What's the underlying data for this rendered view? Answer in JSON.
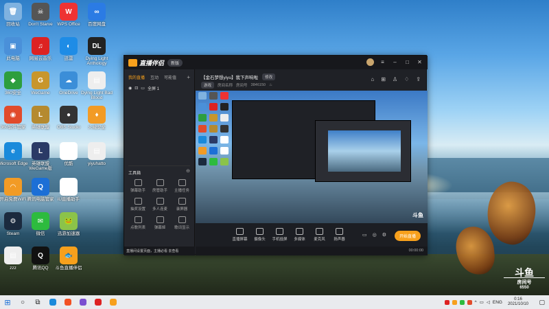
{
  "desktop_icons": [
    {
      "label": "回收站",
      "color": "#7fb2e0",
      "glyph": "🗑"
    },
    {
      "label": "Don't Starve",
      "color": "#555",
      "glyph": "☠"
    },
    {
      "label": "WPS Office",
      "color": "#e33",
      "glyph": "W"
    },
    {
      "label": "百度网盘",
      "color": "#2b7be4",
      "glyph": "∞"
    },
    {
      "label": "此电脑",
      "color": "#4a90d9",
      "glyph": "▣"
    },
    {
      "label": "网易云音乐",
      "color": "#d22",
      "glyph": "♫"
    },
    {
      "label": "迅雷",
      "color": "#1e8ce6",
      "glyph": "◐"
    },
    {
      "label": "Dying Light Anthology",
      "color": "#222",
      "glyph": "DL"
    },
    {
      "label": "360安全",
      "color": "#2d9e3e",
      "glyph": "◆"
    },
    {
      "label": "WeGame",
      "color": "#c8962c",
      "glyph": "G"
    },
    {
      "label": "OneDrive",
      "color": "#3b8ed8",
      "glyph": "☁"
    },
    {
      "label": "Dying Light Bad Blood",
      "color": "#eee",
      "glyph": "▤"
    },
    {
      "label": "360软件管家",
      "color": "#e14b2b",
      "glyph": "◉"
    },
    {
      "label": "英雄联盟",
      "color": "#b58a30",
      "glyph": "L"
    },
    {
      "label": "OBS Studio",
      "color": "#333",
      "glyph": "●"
    },
    {
      "label": "火绒安全",
      "color": "#f29b25",
      "glyph": "♦"
    },
    {
      "label": "Microsoft Edge",
      "color": "#1a8adb",
      "glyph": "e"
    },
    {
      "label": "英雄联盟WeGame版",
      "color": "#2a3a66",
      "glyph": "L"
    },
    {
      "label": "优酷",
      "color": "#fff",
      "glyph": "Y"
    },
    {
      "label": "yiyuhatto",
      "color": "#eee",
      "glyph": "▤"
    },
    {
      "label": "开启免费WiFi",
      "color": "#f29b25",
      "glyph": "◠"
    },
    {
      "label": "腾讯电脑管家",
      "color": "#1c6fd6",
      "glyph": "Q"
    },
    {
      "label": "iU直播助手",
      "color": "#fff",
      "glyph": "iU"
    },
    {
      "label": "Steam",
      "color": "#1b2a3e",
      "glyph": "⚙"
    },
    {
      "label": "微信",
      "color": "#2dbb3e",
      "glyph": "✉"
    },
    {
      "label": "迅游加速器",
      "color": "#8bc34a",
      "glyph": "🐸"
    },
    {
      "label": "zzz",
      "color": "#eee",
      "glyph": "▤"
    },
    {
      "label": "腾讯QQ",
      "color": "#111",
      "glyph": "Q"
    },
    {
      "label": "斗鱼直播伴侣",
      "color": "#f7a01c",
      "glyph": "🐟"
    }
  ],
  "app": {
    "brand": "直播伴侣",
    "version": "新版",
    "left_tabs": [
      "我的直播",
      "互动",
      "可能值"
    ],
    "scene_label": "全屏 1",
    "tools_title": "工具箱",
    "tools": [
      {
        "label": "弹幕助手"
      },
      {
        "label": "房管助手"
      },
      {
        "label": "主播任务"
      },
      {
        "label": "抽奖设置"
      },
      {
        "label": "多人连麦"
      },
      {
        "label": "录屏器"
      },
      {
        "label": "点歌列表"
      },
      {
        "label": "弹幕姬"
      },
      {
        "label": "歌词显示"
      }
    ],
    "left_status": "直播间设置页面，主播必看 去查看",
    "room_title": "【金石梦想yiyu】我下声响啦",
    "room_badge": "修改",
    "room_sub": [
      "游戏",
      "房间名称",
      "房间号",
      "3846150"
    ],
    "bottom_tools": [
      "直播屏幕",
      "摄像头",
      "手机投屏",
      "多媒体",
      "麦克风",
      "扬声器"
    ],
    "start_button": "开始直播",
    "timer": "00:00:00",
    "preview_watermark": "斗鱼"
  },
  "watermark": {
    "line1": "斗鱼",
    "line2": "房间号",
    "line3": "6550"
  },
  "taskbar": {
    "lang": "ENG",
    "time": "0:16",
    "date": "2021/10/10",
    "apps": [
      {
        "name": "edge",
        "color": "#1a8adb"
      },
      {
        "name": "store",
        "color": "#f25022"
      },
      {
        "name": "visual-studio",
        "color": "#7b4fd0"
      },
      {
        "name": "netease-music",
        "color": "#d22"
      },
      {
        "name": "douyu",
        "color": "#f7a01c"
      }
    ]
  }
}
